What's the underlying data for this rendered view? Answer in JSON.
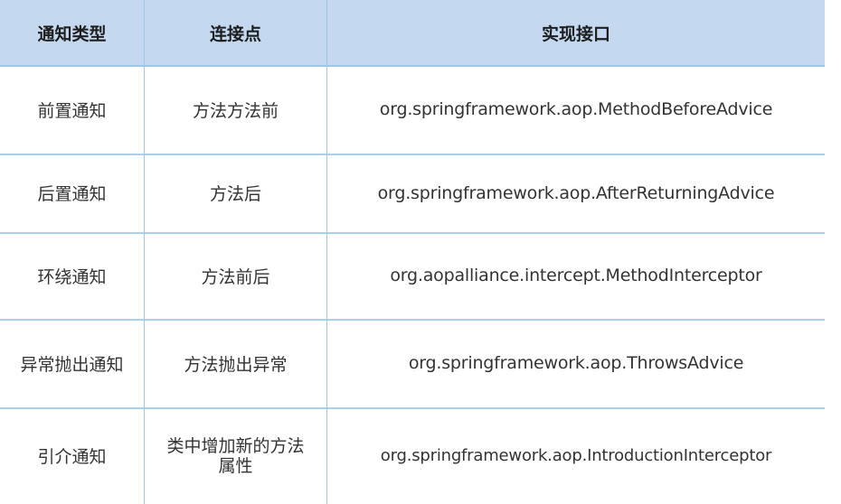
{
  "table": {
    "headers": [
      "通知类型",
      "连接点",
      "实现接口"
    ],
    "rows": [
      [
        "前置通知",
        "方法方法前",
        "org.springframework.aop.MethodBeforeAdvice"
      ],
      [
        "后置通知",
        "方法后",
        "org.springframework.aop.AfterReturningAdvice"
      ],
      [
        "环绕通知",
        "方法前后",
        "org.aopalliance.intercept.MethodInterceptor"
      ],
      [
        "异常抛出通知",
        "方法抛出异常",
        "org.springframework.aop.ThrowsAdvice"
      ],
      [
        "引介通知",
        "类中增加新的方法属性",
        "org.springframework.aop.IntroductionInterceptor"
      ]
    ]
  },
  "colors": {
    "header_bg": "#c4d9ef",
    "grid_line": "#9cc7e6"
  }
}
